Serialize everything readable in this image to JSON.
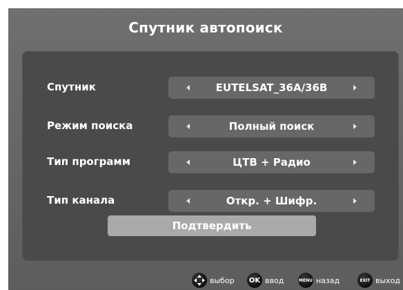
{
  "title": "Спутник автопоиск",
  "rows": [
    {
      "label": "Спутник",
      "value": "EUTELSAT_36A/36B"
    },
    {
      "label": "Режим поиска",
      "value": "Полный поиск"
    },
    {
      "label": "Тип программ",
      "value": "ЦТВ + Радио"
    },
    {
      "label": "Тип канала",
      "value": "Откр. + Шифр."
    }
  ],
  "confirm_label": "Подтвердить",
  "hints": [
    {
      "icon": "nav-pad-icon",
      "text": "выбор"
    },
    {
      "icon": "ok-icon",
      "icon_text": "OK",
      "text": "ввод"
    },
    {
      "icon": "menu-icon",
      "icon_text": "MENU",
      "text": "назад"
    },
    {
      "icon": "exit-icon",
      "icon_text": "EXIT",
      "text": "выход"
    }
  ],
  "colors": {
    "background": "#686868",
    "panel": "#4a4a4a",
    "field": "#676767",
    "confirm": "#a9a9a9",
    "text": "#ffffff"
  }
}
